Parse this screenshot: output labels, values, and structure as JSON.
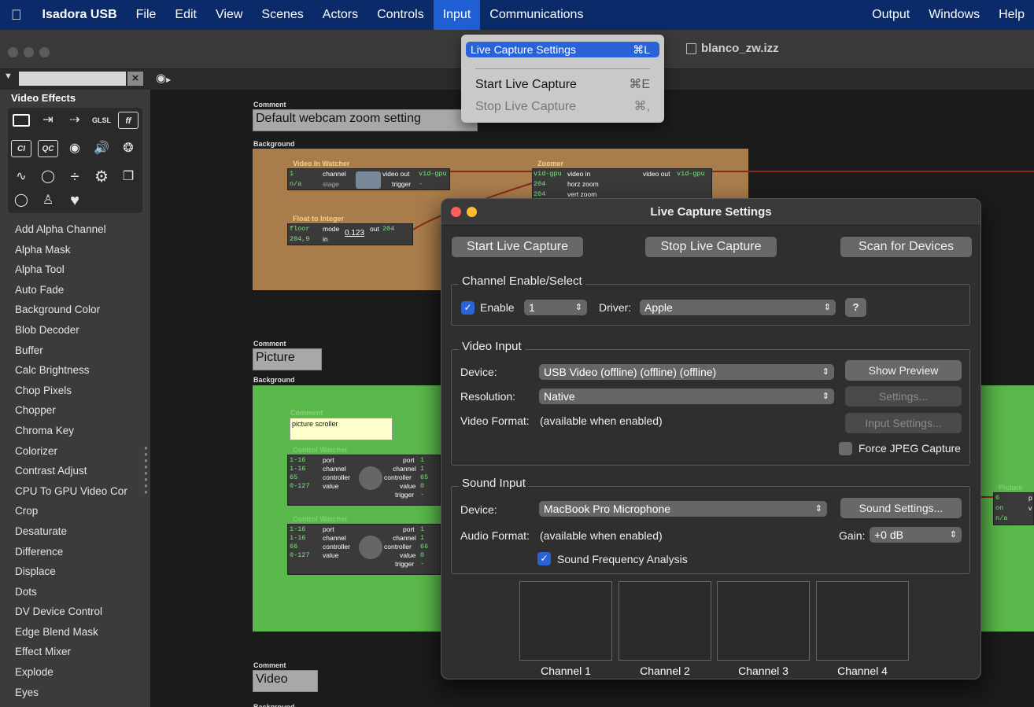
{
  "menubar": {
    "apple": "",
    "app_name": "Isadora USB",
    "items": [
      "File",
      "Edit",
      "View",
      "Scenes",
      "Actors",
      "Controls",
      "Input",
      "Communications"
    ],
    "right_items": [
      "Output",
      "Windows",
      "Help"
    ]
  },
  "window": {
    "file_title": "blanco_zw.izz"
  },
  "input_menu": {
    "items": [
      {
        "label": "Live Capture Settings",
        "shortcut": "⌘L"
      },
      {
        "label": "Start Live Capture",
        "shortcut": "⌘E"
      },
      {
        "label": "Stop Live Capture",
        "shortcut": "⌘,"
      }
    ]
  },
  "sidebar": {
    "category": "Video Effects",
    "palette_icons": [
      "",
      "",
      "",
      "GLSL",
      "ff",
      "CI",
      "QC",
      "",
      "",
      "",
      "∿",
      "",
      "÷",
      "",
      "",
      "",
      "",
      "♥"
    ],
    "effects": [
      "Add Alpha Channel",
      "Alpha Mask",
      "Alpha Tool",
      "Auto Fade",
      "Background Color",
      "Blob Decoder",
      "Buffer",
      "Calc Brightness",
      "Chop Pixels",
      "Chopper",
      "Chroma Key",
      "Colorizer",
      "Contrast Adjust",
      "CPU To GPU Video Cor",
      "Crop",
      "Desaturate",
      "Difference",
      "Displace",
      "Dots",
      "DV Device Control",
      "Edge Blend Mask",
      "Effect Mixer",
      "Explode",
      "Eyes"
    ]
  },
  "canvas": {
    "comment_label": "Comment",
    "background_label": "Background",
    "comment1": "Default webcam zoom setting",
    "comment2": "Picture",
    "comment3": "Video",
    "video_in_watcher": {
      "title": "Video In Watcher",
      "in_values": [
        "1",
        "n/a"
      ],
      "in_labels": [
        "channel",
        "stage"
      ],
      "out_labels": [
        "video out",
        "trigger"
      ],
      "out_values": [
        "vid-gpu",
        "-"
      ]
    },
    "zoomer": {
      "title": "Zoomer",
      "in_values": [
        "vid-gpu",
        "204",
        "204"
      ],
      "in_labels": [
        "video in",
        "horz zoom",
        "vert zoom"
      ],
      "out_label": "video out",
      "out_value": "vid-gpu"
    },
    "float_to_integer": {
      "title": "Float to Integer",
      "in_values": [
        "floor",
        "204,9"
      ],
      "in_labels": [
        "mode",
        "in"
      ],
      "mid_value": "0.123",
      "out_label": "out",
      "out_value": "204"
    },
    "picture_scroller": {
      "title": "Comment",
      "text": "picture scroller"
    },
    "control_watcher1": {
      "title": "Control Watcher",
      "in_values": [
        "1-16",
        "1-16",
        "65",
        "0-127"
      ],
      "in_labels": [
        "port",
        "channel",
        "controller",
        "value"
      ],
      "out_labels": [
        "port",
        "channel",
        "controller",
        "value",
        "trigger"
      ],
      "out_values": [
        "1",
        "1",
        "65",
        "0",
        "-"
      ]
    },
    "control_watcher2": {
      "title": "Control Watcher",
      "in_values": [
        "1-16",
        "1-16",
        "66",
        "0-127"
      ],
      "in_labels": [
        "port",
        "channel",
        "controller",
        "value"
      ],
      "out_labels": [
        "port",
        "channel",
        "controller",
        "value",
        "trigger"
      ],
      "out_values": [
        "1",
        "1",
        "66",
        "0",
        "-"
      ]
    },
    "picture_actor": {
      "title": "Picture",
      "in_values": [
        "6",
        "on",
        "n/a"
      ],
      "out_labels": [
        "p",
        "v"
      ]
    }
  },
  "dialog": {
    "title": "Live Capture Settings",
    "start_button": "Start Live Capture",
    "stop_button": "Stop Live Capture",
    "scan_button": "Scan for Devices",
    "channel_group": {
      "title": "Channel Enable/Select",
      "enable_label": "Enable",
      "channel_value": "1",
      "driver_label": "Driver:",
      "driver_value": "Apple",
      "help_label": "?"
    },
    "video_group": {
      "title": "Video Input",
      "device_label": "Device:",
      "device_value": "USB Video (offline) (offline) (offline)",
      "resolution_label": "Resolution:",
      "resolution_value": "Native",
      "format_label": "Video Format:",
      "format_value": "(available when enabled)",
      "show_preview": "Show Preview",
      "settings": "Settings...",
      "input_settings": "Input Settings...",
      "force_jpeg": "Force JPEG Capture"
    },
    "sound_group": {
      "title": "Sound Input",
      "device_label": "Device:",
      "device_value": "MacBook Pro Microphone",
      "sound_settings": "Sound Settings...",
      "format_label": "Audio Format:",
      "format_value": "(available when enabled)",
      "gain_label": "Gain:",
      "gain_value": "+0 dB",
      "freq_analysis": "Sound Frequency Analysis"
    },
    "channels": [
      "Channel 1",
      "Channel 2",
      "Channel 3",
      "Channel 4"
    ]
  },
  "colors": {
    "menubar": "#0a2a6a",
    "accent": "#2a63d8",
    "brown_bg": "#a97c4b",
    "green_bg": "#5bb84c",
    "close_dot": "#ff5f57",
    "min_dot": "#febc2e"
  }
}
